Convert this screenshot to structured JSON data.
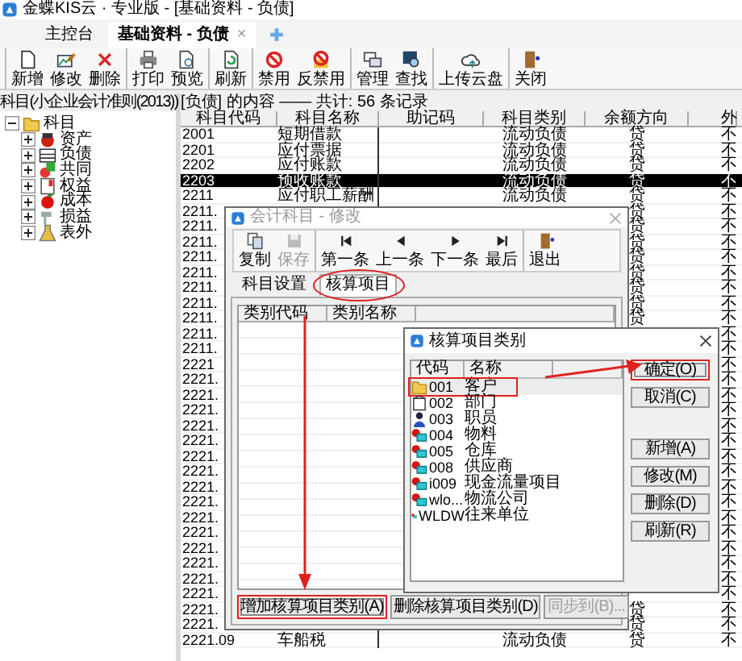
{
  "window": {
    "title": "金蝶KIS云 · 专业版 - [基础资料 - 负债]"
  },
  "tabs": [
    {
      "label": "主控台",
      "selected": false
    },
    {
      "label": "基础资料 - 负债",
      "selected": true,
      "close": "×"
    }
  ],
  "toolbar": [
    [
      "新增",
      "修改",
      "删除"
    ],
    [
      "打印",
      "预览"
    ],
    [
      "刷新"
    ],
    [
      "禁用",
      "反禁用"
    ],
    [
      "管理",
      "查找"
    ],
    [
      "上传云盘"
    ],
    [
      "关闭"
    ]
  ],
  "sidebar": {
    "title": "科目(小企业会计准则(2013))",
    "tree": [
      {
        "label": "科目",
        "expanded": true,
        "children": [
          {
            "label": "资产",
            "expanded": false
          },
          {
            "label": "负债",
            "expanded": false
          },
          {
            "label": "共同",
            "expanded": false
          },
          {
            "label": "权益",
            "expanded": false
          },
          {
            "label": "成本",
            "expanded": false
          },
          {
            "label": "损益",
            "expanded": false
          },
          {
            "label": "表外",
            "expanded": false
          }
        ]
      }
    ]
  },
  "content": {
    "summary": "[负债] 的内容 —— 共计: 56 条记录",
    "columns": [
      "科目代码",
      "科目名称",
      "助记码",
      "科目类别",
      "余额方向",
      "外"
    ],
    "rows": [
      {
        "code": "2001",
        "name": "短期借款",
        "category": "流动负债",
        "direction": "贷",
        "currency": "不",
        "selected": false
      },
      {
        "code": "2201",
        "name": "应付票据",
        "category": "流动负债",
        "direction": "贷",
        "currency": "不",
        "selected": false
      },
      {
        "code": "2202",
        "name": "应付账款",
        "category": "流动负债",
        "direction": "贷",
        "currency": "不",
        "selected": false
      },
      {
        "code": "2203",
        "name": "预收账款",
        "category": "流动负债",
        "direction": "贷",
        "currency": "不",
        "selected": true
      },
      {
        "code": "2211",
        "name": "应付职工薪酬",
        "category": "流动负债",
        "direction": "贷",
        "currency": "不",
        "selected": false
      },
      {
        "code": "2211.",
        "direction": "贷",
        "currency": "不",
        "selected": false
      },
      {
        "code": "2211.",
        "direction": "贷",
        "currency": "不",
        "selected": false
      },
      {
        "code": "2211.",
        "direction": "贷",
        "currency": "不",
        "selected": false
      },
      {
        "code": "2211.",
        "direction": "贷",
        "currency": "不",
        "selected": false
      },
      {
        "code": "2211.",
        "direction": "贷",
        "currency": "不",
        "selected": false
      },
      {
        "code": "2211.",
        "direction": "贷",
        "currency": "不",
        "selected": false
      },
      {
        "code": "2211.",
        "direction": "贷",
        "currency": "不",
        "selected": false
      },
      {
        "code": "2211.",
        "direction": "贷",
        "currency": "不",
        "selected": false
      },
      {
        "code": "2211.",
        "currency": "不",
        "selected": false
      },
      {
        "code": "2211.",
        "currency": "不",
        "selected": false
      },
      {
        "code": "2221",
        "currency": "不",
        "selected": false
      },
      {
        "code": "2221.",
        "currency": "不",
        "selected": false
      },
      {
        "code": "2221.",
        "currency": "不",
        "selected": false
      },
      {
        "code": "2221.",
        "currency": "不",
        "selected": false
      },
      {
        "code": "2221.",
        "currency": "不",
        "selected": false
      },
      {
        "code": "2221.",
        "currency": "不",
        "selected": false
      },
      {
        "code": "2221.",
        "currency": "不",
        "selected": false
      },
      {
        "code": "2221.",
        "currency": "不",
        "selected": false
      },
      {
        "code": "2221.",
        "currency": "不",
        "selected": false
      },
      {
        "code": "2221.",
        "currency": "不",
        "selected": false
      },
      {
        "code": "2221.",
        "currency": "不",
        "selected": false
      },
      {
        "code": "2221.",
        "currency": "不",
        "selected": false
      },
      {
        "code": "2221.",
        "currency": "不",
        "selected": false
      },
      {
        "code": "2221.",
        "currency": "不",
        "selected": false
      },
      {
        "code": "2221.",
        "currency": "不",
        "selected": false
      },
      {
        "code": "2221.",
        "currency": "不",
        "selected": false
      },
      {
        "code": "2221.",
        "direction": "贷",
        "currency": "不",
        "selected": false
      },
      {
        "code": "2221.",
        "direction": "贷",
        "currency": "不",
        "selected": false
      },
      {
        "code": "2221.09",
        "name": "车船税",
        "category": "流动负债",
        "direction": "贷",
        "currency": "不",
        "selected": false
      }
    ]
  },
  "dialog_edit": {
    "title": "会计科目 - 修改",
    "active": false,
    "toolbar": [
      [
        {
          "label": "复制",
          "disabled": false
        },
        {
          "label": "保存",
          "disabled": true
        }
      ],
      [
        {
          "label": "第一条",
          "disabled": false
        },
        {
          "label": "上一条",
          "disabled": false
        },
        {
          "label": "下一条",
          "disabled": false
        },
        {
          "label": "最后",
          "disabled": false
        }
      ],
      [
        {
          "label": "退出",
          "disabled": false
        }
      ]
    ],
    "tabs": [
      {
        "label": "科目设置",
        "selected": false,
        "highlighted": false
      },
      {
        "label": "核算项目",
        "selected": true,
        "highlighted": true
      }
    ],
    "grid_columns": [
      "类别代码",
      "类别名称"
    ],
    "buttons": [
      {
        "label": "增加核算项目类别(A)",
        "disabled": false,
        "highlighted": true
      },
      {
        "label": "删除核算项目类别(D)",
        "disabled": false,
        "highlighted": false
      },
      {
        "label": "同步到(B)...",
        "disabled": true,
        "highlighted": false
      }
    ]
  },
  "dialog_categories": {
    "title": "核算项目类别",
    "active": true,
    "columns": [
      "代码",
      "名称"
    ],
    "rows": [
      {
        "code": "001",
        "name": "客户",
        "selected": true,
        "highlighted": true
      },
      {
        "code": "002",
        "name": "部门",
        "selected": false,
        "highlighted": false
      },
      {
        "code": "003",
        "name": "职员",
        "selected": false,
        "highlighted": false
      },
      {
        "code": "004",
        "name": "物料",
        "selected": false,
        "highlighted": false
      },
      {
        "code": "005",
        "name": "仓库",
        "selected": false,
        "highlighted": false
      },
      {
        "code": "008",
        "name": "供应商",
        "selected": false,
        "highlighted": false
      },
      {
        "code": "i009",
        "name": "现金流量项目",
        "selected": false,
        "highlighted": false
      },
      {
        "code": "wlo...",
        "name": "物流公司",
        "selected": false,
        "highlighted": false
      },
      {
        "code": "WLDW",
        "name": "往来单位",
        "selected": false,
        "highlighted": false
      }
    ],
    "button_groups": [
      [
        {
          "label": "确定(O)",
          "highlighted": true
        },
        {
          "label": "取消(C)",
          "highlighted": false
        }
      ],
      [
        {
          "label": "新增(A)",
          "highlighted": false
        },
        {
          "label": "修改(M)",
          "highlighted": false
        },
        {
          "label": "删除(D)",
          "highlighted": false
        },
        {
          "label": "刷新(R)",
          "highlighted": false
        }
      ]
    ]
  }
}
